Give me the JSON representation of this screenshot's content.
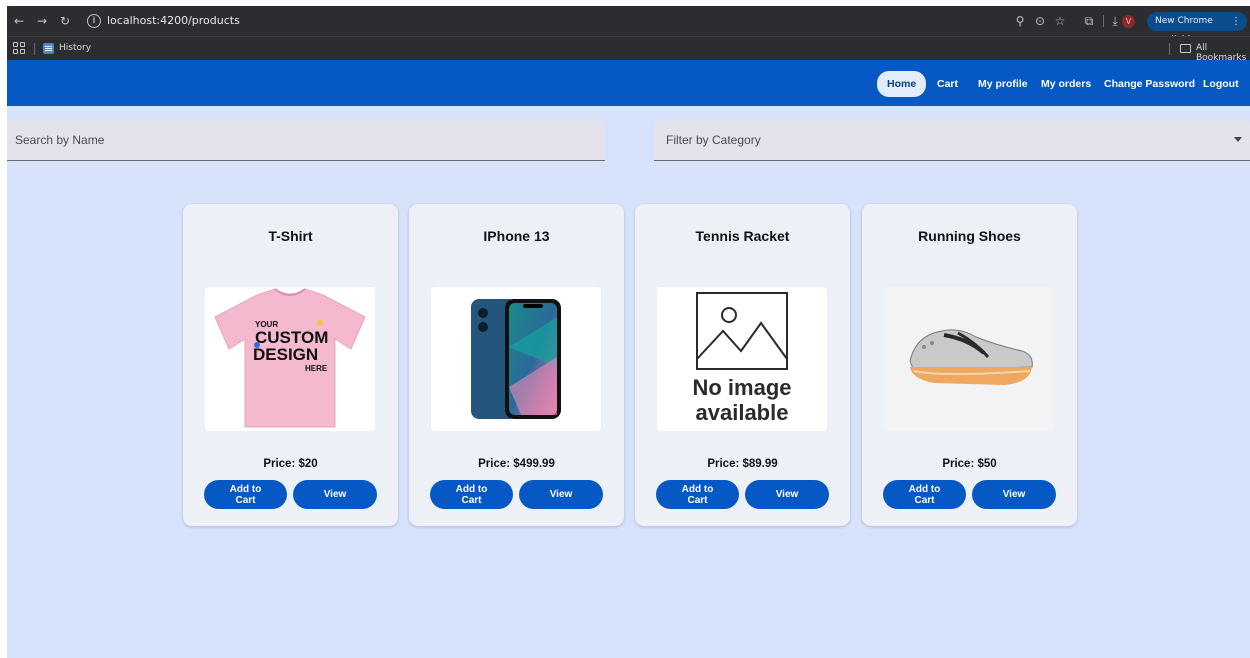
{
  "browser": {
    "url": "localhost:4200/products",
    "avatar_letter": "V",
    "new_chrome_label": "New Chrome available",
    "bookmarks": {
      "history": "History",
      "all_bookmarks": "All Bookmarks"
    }
  },
  "header": {
    "nav": [
      {
        "label": "Home",
        "active": true
      },
      {
        "label": "Cart"
      },
      {
        "label": "My profile"
      },
      {
        "label": "My orders"
      },
      {
        "label": "Change Password"
      },
      {
        "label": "Logout"
      }
    ]
  },
  "filters": {
    "search_placeholder": "Search by Name",
    "category_placeholder": "Filter by Category"
  },
  "products": [
    {
      "name": "T-Shirt",
      "price": "Price: $20",
      "image": "tshirt-image",
      "image_text": [
        "YOUR",
        "CUSTOM",
        "DESIGN",
        "HERE"
      ]
    },
    {
      "name": "IPhone 13",
      "price": "Price: $499.99",
      "image": "phone-image"
    },
    {
      "name": "Tennis Racket",
      "price": "Price: $89.99",
      "image": "no-image-placeholder",
      "image_text": [
        "No image",
        "available"
      ]
    },
    {
      "name": "Running Shoes",
      "price": "Price: $50",
      "image": "shoe-image"
    }
  ],
  "buttons": {
    "add_to_cart": "Add to Cart",
    "view": "View"
  },
  "colors": {
    "primary": "#0659c4",
    "page_bg": "#d6e3fb",
    "card_bg": "#eef0f8"
  }
}
